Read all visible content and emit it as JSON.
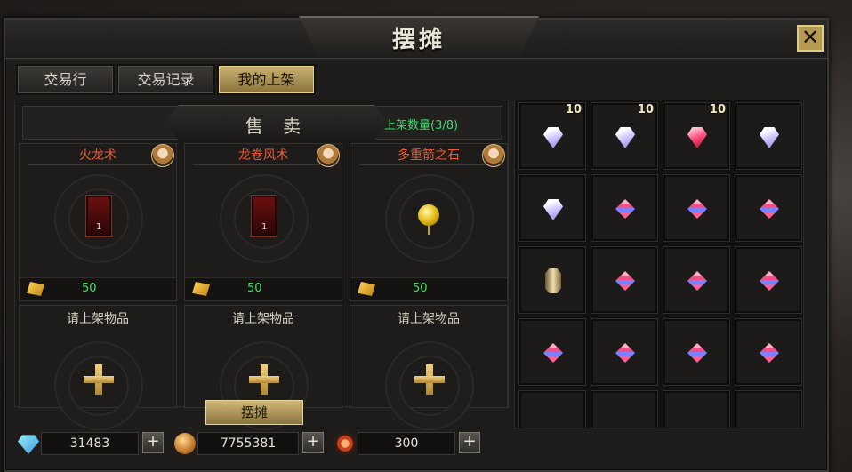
{
  "title": "摆摊",
  "close_label": "✕",
  "tabs": [
    {
      "label": "交易行",
      "active": false
    },
    {
      "label": "交易记录",
      "active": false
    },
    {
      "label": "我的上架",
      "active": true
    }
  ],
  "sale": {
    "title": "售 卖",
    "listing_count": "上架数量(3/8)"
  },
  "listings": [
    {
      "name": "火龙术",
      "price": "50",
      "item_icon": "scroll-icon",
      "item_label": "1"
    },
    {
      "name": "龙卷风术",
      "price": "50",
      "item_icon": "scroll-icon",
      "item_label": "1"
    },
    {
      "name": "多重箭之石",
      "price": "50",
      "item_icon": "golden-orb-icon",
      "item_label": ""
    }
  ],
  "empty_slots": [
    {
      "label": "请上架物品"
    },
    {
      "label": "请上架物品"
    },
    {
      "label": "请上架物品"
    }
  ],
  "stall_button": "摆摊",
  "currencies": [
    {
      "icon": "diamond-icon",
      "value": "31483"
    },
    {
      "icon": "copper-coin-icon",
      "value": "7755381"
    },
    {
      "icon": "sun-emblem-icon",
      "value": "300"
    }
  ],
  "currency_add_label": "+",
  "inventory": [
    {
      "gem": "white",
      "count": "10"
    },
    {
      "gem": "white",
      "count": "10"
    },
    {
      "gem": "pink",
      "count": "10"
    },
    {
      "gem": "white",
      "count": ""
    },
    {
      "gem": "white",
      "count": ""
    },
    {
      "gem": "multi",
      "count": ""
    },
    {
      "gem": "multi",
      "count": ""
    },
    {
      "gem": "multi",
      "count": ""
    },
    {
      "gem": "crystal",
      "count": ""
    },
    {
      "gem": "multi",
      "count": ""
    },
    {
      "gem": "multi",
      "count": ""
    },
    {
      "gem": "multi",
      "count": ""
    },
    {
      "gem": "multi",
      "count": ""
    },
    {
      "gem": "multi",
      "count": ""
    },
    {
      "gem": "multi",
      "count": ""
    },
    {
      "gem": "multi",
      "count": ""
    },
    {
      "gem": "",
      "count": ""
    },
    {
      "gem": "",
      "count": ""
    },
    {
      "gem": "",
      "count": ""
    },
    {
      "gem": "",
      "count": ""
    }
  ],
  "colors": {
    "accent_gold": "#c8b070",
    "item_name_red": "#f05a3a",
    "price_green": "#3fe064"
  }
}
